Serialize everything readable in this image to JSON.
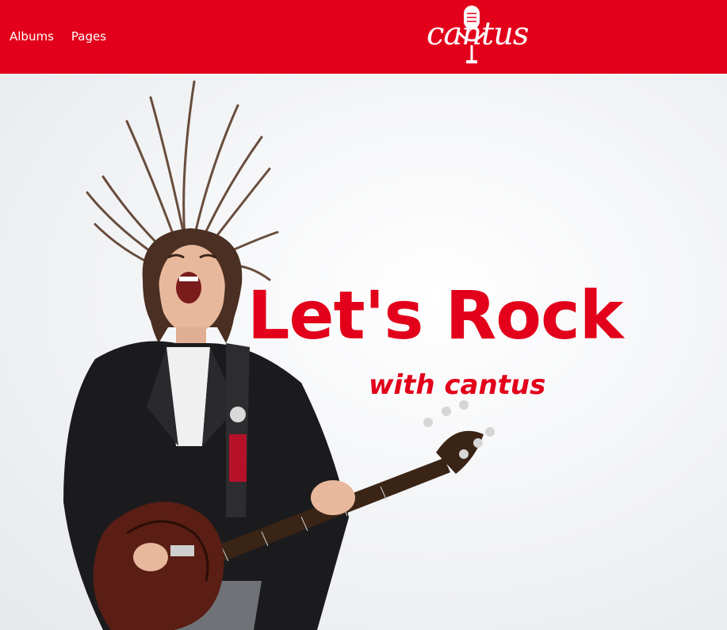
{
  "header": {
    "background_color": "#e2001a",
    "nav": [
      {
        "label": "Albums"
      },
      {
        "label": "Pages"
      }
    ],
    "logo": {
      "text": "cantus",
      "icon": "microphone-icon"
    }
  },
  "hero": {
    "headline": "Let's Rock",
    "subheadline": "with cantus",
    "accent_color": "#e2001a",
    "image": "rock-guitarist-photo"
  }
}
